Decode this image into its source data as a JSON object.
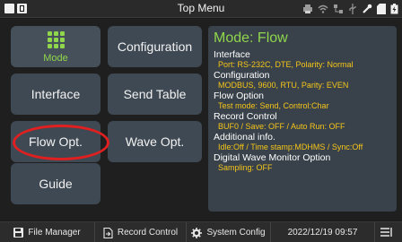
{
  "topbar": {
    "title": "Top Menu"
  },
  "status_icons": [
    "printer-icon",
    "wifi-icon",
    "network-icon",
    "usb-icon",
    "tool-icon",
    "sd-card-icon",
    "battery-icon"
  ],
  "tiles": {
    "mode": "Mode",
    "configuration": "Configuration",
    "interface": "Interface",
    "send_table": "Send Table",
    "flow_opt": "Flow Opt.",
    "wave_opt": "Wave Opt.",
    "guide": "Guide"
  },
  "panel": {
    "title": "Mode: Flow",
    "sections": [
      {
        "title": "Interface",
        "value": "Port: RS-232C, DTE, Polarity: Normal"
      },
      {
        "title": "Configuration",
        "value": "MODBUS, 9600, RTU, Parity: EVEN"
      },
      {
        "title": "Flow Option",
        "value": "Test mode: Send, Control:Char"
      },
      {
        "title": "Record Control",
        "value": "BUF0 / Save: OFF / Auto Run: OFF"
      },
      {
        "title": "Additional info.",
        "value": "Idle:Off / Time stamp:MDHMS / Sync:Off"
      },
      {
        "title": "Digital Wave Monitor Option",
        "value": "Sampling: OFF"
      }
    ]
  },
  "bottombar": {
    "file_manager": "File Manager",
    "record_control": "Record Control",
    "system_config": "System Config",
    "datetime": "2022/12/19 09:57"
  },
  "colors": {
    "accent_green": "#8fd64b",
    "value_yellow": "#f5c518",
    "highlight_red": "#e02020"
  }
}
